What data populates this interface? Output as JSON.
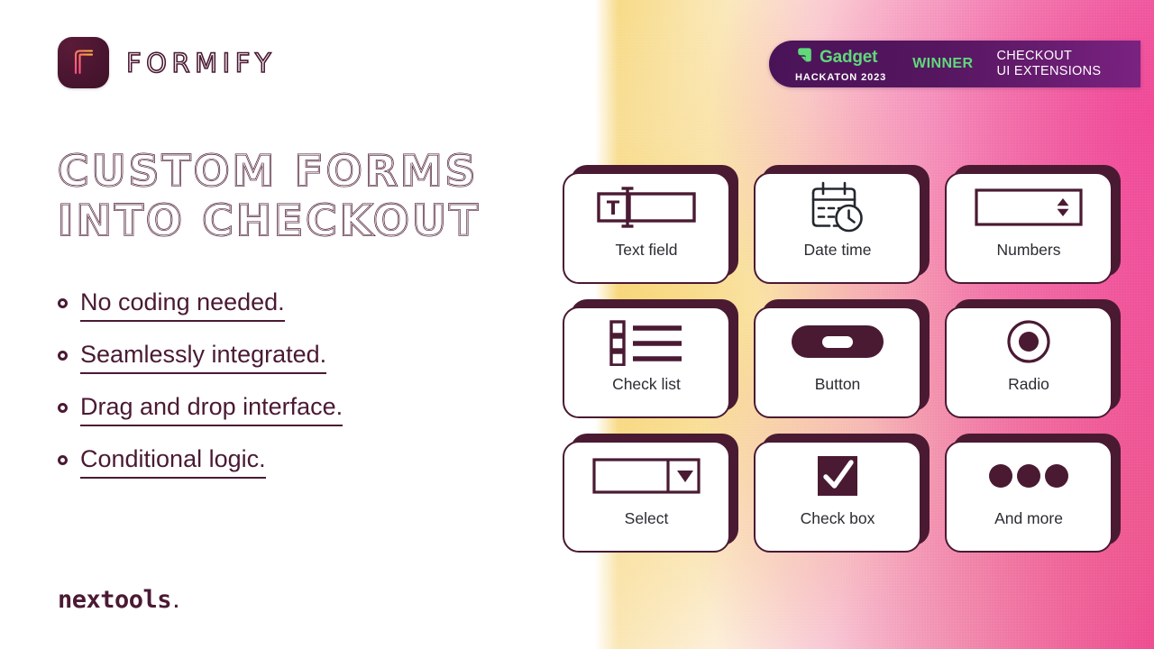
{
  "brand": {
    "logo_icon": "formify-f-mark",
    "name": "FORMIFY"
  },
  "headline": {
    "line1": "Custom Forms",
    "line2": "Into Checkout"
  },
  "bullets": [
    {
      "text": "No coding needed."
    },
    {
      "text": "Seamlessly integrated."
    },
    {
      "text": "Drag and drop interface."
    },
    {
      "text": "Conditional logic."
    }
  ],
  "footer": {
    "company": "nextools",
    "company_dot": "."
  },
  "badge": {
    "gadget_name": "Gadget",
    "gadget_logo_icon": "gadget-cube-icon",
    "hackathon": "HACKATON 2023",
    "winner": "WINNER",
    "category_line1": "CHECKOUT",
    "category_line2": "UI EXTENSIONS"
  },
  "cards": [
    {
      "label": "Text field",
      "icon": "text-field-icon"
    },
    {
      "label": "Date time",
      "icon": "calendar-clock-icon"
    },
    {
      "label": "Numbers",
      "icon": "number-stepper-icon"
    },
    {
      "label": "Check list",
      "icon": "check-list-icon"
    },
    {
      "label": "Button",
      "icon": "button-pill-icon"
    },
    {
      "label": "Radio",
      "icon": "radio-button-icon"
    },
    {
      "label": "Select",
      "icon": "select-dropdown-icon"
    },
    {
      "label": "Check box",
      "icon": "check-box-icon"
    },
    {
      "label": "And more",
      "icon": "ellipsis-icon"
    }
  ],
  "colors": {
    "primary_maroon": "#4a1a33",
    "badge_purple": "#55165f",
    "accent_green": "#5fd97a",
    "gradient_yellow": "#f6d77a",
    "gradient_pink": "#ed3f95",
    "icon_dark": "#2b2b33"
  }
}
